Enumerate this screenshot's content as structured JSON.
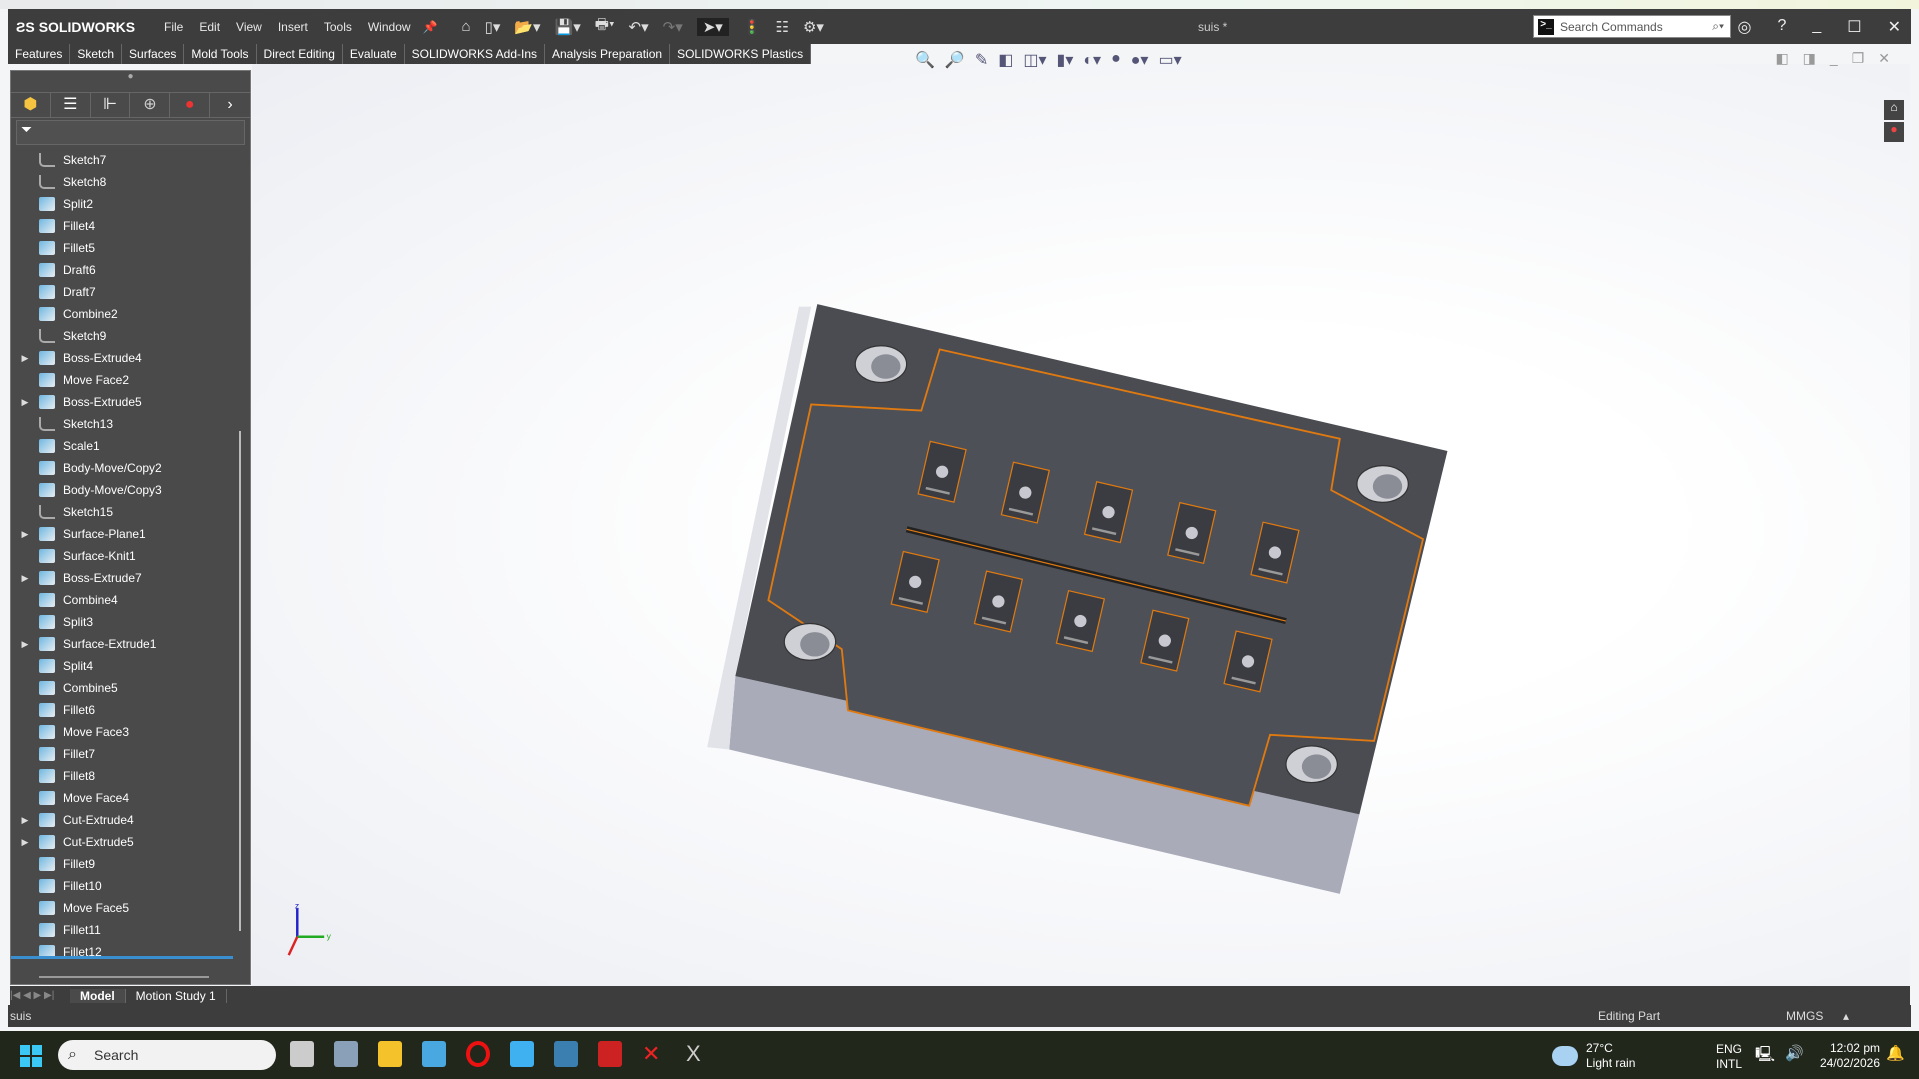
{
  "app": {
    "brand": "SOLIDWORKS",
    "title": "suis *"
  },
  "menu": [
    "File",
    "Edit",
    "View",
    "Insert",
    "Tools",
    "Window"
  ],
  "search": {
    "placeholder": "Search Commands"
  },
  "command_tabs": [
    "Features",
    "Sketch",
    "Surfaces",
    "Mold Tools",
    "Direct Editing",
    "Evaluate",
    "SOLIDWORKS Add-Ins",
    "Analysis Preparation",
    "SOLIDWORKS Plastics"
  ],
  "tree": [
    {
      "label": "Sketch7",
      "type": "sketch",
      "expandable": false
    },
    {
      "label": "Sketch8",
      "type": "sketch",
      "expandable": false
    },
    {
      "label": "Split2",
      "type": "feature",
      "expandable": false
    },
    {
      "label": "Fillet4",
      "type": "feature",
      "expandable": false
    },
    {
      "label": "Fillet5",
      "type": "feature",
      "expandable": false
    },
    {
      "label": "Draft6",
      "type": "feature",
      "expandable": false
    },
    {
      "label": "Draft7",
      "type": "feature",
      "expandable": false
    },
    {
      "label": "Combine2",
      "type": "feature",
      "expandable": false
    },
    {
      "label": "Sketch9",
      "type": "sketch",
      "expandable": false
    },
    {
      "label": "Boss-Extrude4",
      "type": "feature",
      "expandable": true
    },
    {
      "label": "Move Face2",
      "type": "feature",
      "expandable": false
    },
    {
      "label": "Boss-Extrude5",
      "type": "feature",
      "expandable": true
    },
    {
      "label": "Sketch13",
      "type": "sketch",
      "expandable": false
    },
    {
      "label": "Scale1",
      "type": "feature",
      "expandable": false
    },
    {
      "label": "Body-Move/Copy2",
      "type": "feature",
      "expandable": false
    },
    {
      "label": "Body-Move/Copy3",
      "type": "feature",
      "expandable": false
    },
    {
      "label": "Sketch15",
      "type": "sketch",
      "expandable": false
    },
    {
      "label": "Surface-Plane1",
      "type": "feature",
      "expandable": true
    },
    {
      "label": "Surface-Knit1",
      "type": "feature",
      "expandable": false
    },
    {
      "label": "Boss-Extrude7",
      "type": "feature",
      "expandable": true
    },
    {
      "label": "Combine4",
      "type": "feature",
      "expandable": false
    },
    {
      "label": "Split3",
      "type": "feature",
      "expandable": false
    },
    {
      "label": "Surface-Extrude1",
      "type": "feature",
      "expandable": true
    },
    {
      "label": "Split4",
      "type": "feature",
      "expandable": false
    },
    {
      "label": "Combine5",
      "type": "feature",
      "expandable": false
    },
    {
      "label": "Fillet6",
      "type": "feature",
      "expandable": false
    },
    {
      "label": "Move Face3",
      "type": "feature",
      "expandable": false
    },
    {
      "label": "Fillet7",
      "type": "feature",
      "expandable": false
    },
    {
      "label": "Fillet8",
      "type": "feature",
      "expandable": false
    },
    {
      "label": "Move Face4",
      "type": "feature",
      "expandable": false
    },
    {
      "label": "Cut-Extrude4",
      "type": "feature",
      "expandable": true
    },
    {
      "label": "Cut-Extrude5",
      "type": "feature",
      "expandable": true
    },
    {
      "label": "Fillet9",
      "type": "feature",
      "expandable": false
    },
    {
      "label": "Fillet10",
      "type": "feature",
      "expandable": false
    },
    {
      "label": "Move Face5",
      "type": "feature",
      "expandable": false
    },
    {
      "label": "Fillet11",
      "type": "feature",
      "expandable": false
    },
    {
      "label": "Fillet12",
      "type": "feature",
      "expandable": false
    }
  ],
  "bottom_tabs": [
    "Model",
    "Motion Study 1"
  ],
  "status": {
    "left": "suis",
    "mode": "Editing Part",
    "units": "MMGS"
  },
  "taskbar": {
    "search": "Search",
    "weather_temp": "27°C",
    "weather_desc": "Light rain",
    "lang1": "ENG",
    "lang2": "INTL",
    "time": "12:02 pm",
    "date": "24/02/2026"
  },
  "colors": {
    "edge_highlight": "#e07a10",
    "part_face": "#4a4c52",
    "part_side": "#a9abb9"
  }
}
